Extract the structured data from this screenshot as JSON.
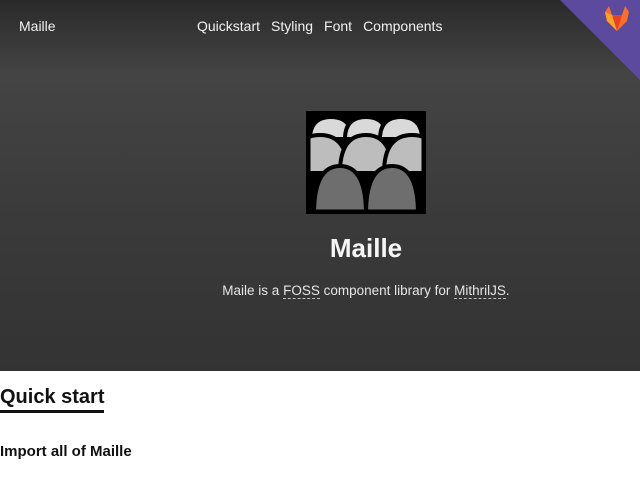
{
  "header": {
    "brand": "Maille",
    "nav": [
      "Quickstart",
      "Styling",
      "Font",
      "Components"
    ]
  },
  "hero": {
    "title": "Maille",
    "tagline_prefix": "Maile is a ",
    "foss_link": "FOSS",
    "tagline_middle": " component library for ",
    "mithril_link": "MithrilJS",
    "tagline_suffix": "."
  },
  "content": {
    "section_title": "Quick start",
    "subsection_title": "Import all of Maille"
  },
  "colors": {
    "corner_ribbon": "#5b4a9e",
    "gitlab_orange": "#fc6d26"
  },
  "icons": {
    "corner": "gitlab-icon",
    "logo": "maille-logo"
  }
}
